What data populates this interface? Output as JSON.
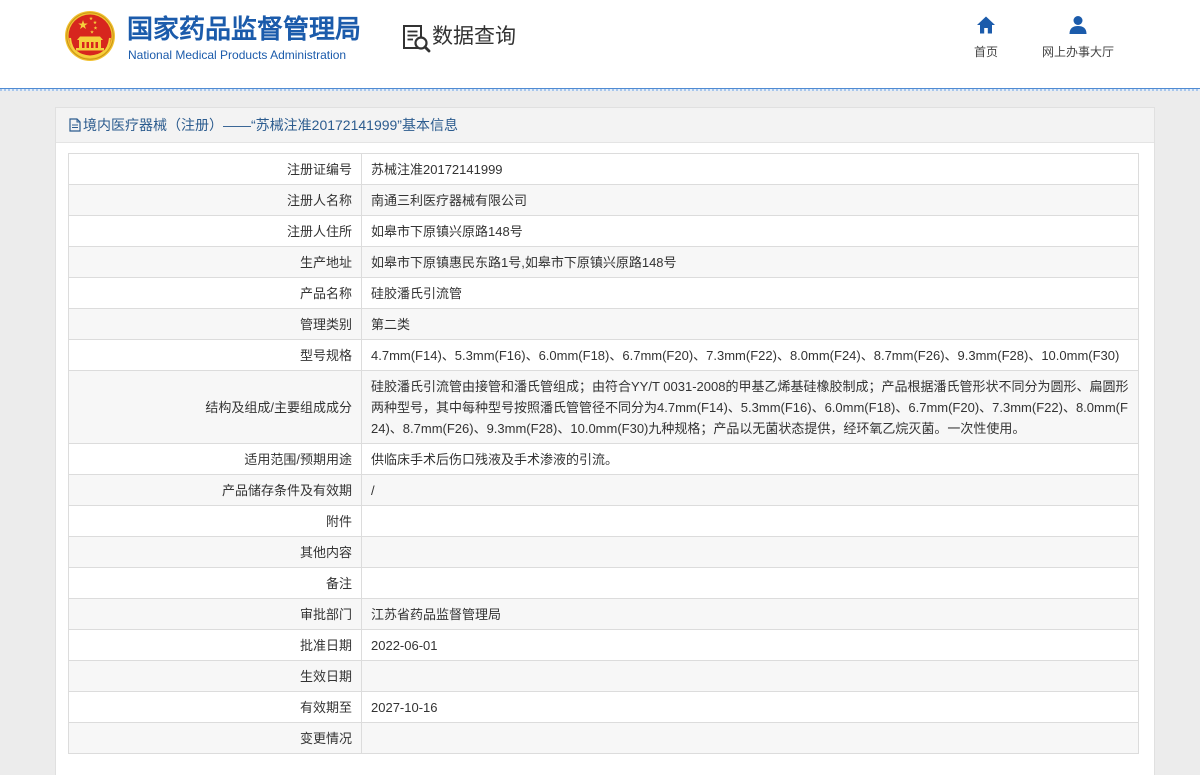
{
  "header": {
    "site_title": "国家药品监督管理局",
    "site_subtitle": "National Medical Products Administration",
    "section_title": "数据查询",
    "nav": [
      {
        "label": "首页",
        "icon": "home-icon"
      },
      {
        "label": "网上办事大厅",
        "icon": "user-icon"
      }
    ]
  },
  "panel": {
    "title": "境内医疗器械（注册）——“苏械注准20172141999”基本信息"
  },
  "details": [
    {
      "label": "注册证编号",
      "value": "苏械注准20172141999"
    },
    {
      "label": "注册人名称",
      "value": "南通三利医疗器械有限公司"
    },
    {
      "label": "注册人住所",
      "value": "如皋市下原镇兴原路148号"
    },
    {
      "label": "生产地址",
      "value": "如皋市下原镇惠民东路1号,如皋市下原镇兴原路148号"
    },
    {
      "label": "产品名称",
      "value": "硅胶潘氏引流管"
    },
    {
      "label": "管理类别",
      "value": "第二类"
    },
    {
      "label": "型号规格",
      "value": "4.7mm(F14)、5.3mm(F16)、6.0mm(F18)、6.7mm(F20)、7.3mm(F22)、8.0mm(F24)、8.7mm(F26)、9.3mm(F28)、10.0mm(F30)"
    },
    {
      "label": "结构及组成/主要组成成分",
      "value": "硅胶潘氏引流管由接管和潘氏管组成；由符合YY/T 0031-2008的甲基乙烯基硅橡胶制成；产品根据潘氏管形状不同分为圆形、扁圆形两种型号，其中每种型号按照潘氏管管径不同分为4.7mm(F14)、5.3mm(F16)、6.0mm(F18)、6.7mm(F20)、7.3mm(F22)、8.0mm(F24)、8.7mm(F26)、9.3mm(F28)、10.0mm(F30)九种规格；产品以无菌状态提供，经环氧乙烷灭菌。一次性使用。"
    },
    {
      "label": "适用范围/预期用途",
      "value": "供临床手术后伤口残液及手术渗液的引流。"
    },
    {
      "label": "产品储存条件及有效期",
      "value": "/"
    },
    {
      "label": "附件",
      "value": ""
    },
    {
      "label": "其他内容",
      "value": ""
    },
    {
      "label": "备注",
      "value": ""
    },
    {
      "label": "审批部门",
      "value": "江苏省药品监督管理局"
    },
    {
      "label": "批准日期",
      "value": "2022-06-01"
    },
    {
      "label": "生效日期",
      "value": ""
    },
    {
      "label": "有效期至",
      "value": "2027-10-16"
    },
    {
      "label": "变更情况",
      "value": ""
    }
  ],
  "icons": {
    "logo": "national-emblem",
    "section": "search-document-icon",
    "panel": "document-icon"
  },
  "colors": {
    "brand_blue": "#1b5bab",
    "panel_title": "#2c5c8f",
    "emblem_red": "#d7261e",
    "emblem_gold": "#f2c230",
    "page_bg": "#ececec",
    "row_alt": "#f7f7f7",
    "border": "#dcdcdc"
  }
}
